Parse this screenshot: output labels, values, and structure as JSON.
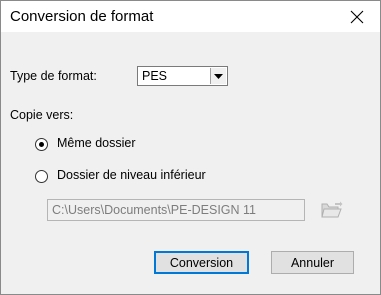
{
  "window": {
    "title": "Conversion de format",
    "close_glyph": "✕"
  },
  "format": {
    "label": "Type de format:",
    "selected": "PES"
  },
  "copy": {
    "label": "Copie vers:",
    "options": [
      {
        "label": "Même dossier",
        "selected": true
      },
      {
        "label": "Dossier de niveau inférieur",
        "selected": false
      }
    ],
    "path": "C:\\Users\\Documents\\PE-DESIGN 11"
  },
  "buttons": {
    "convert": "Conversion",
    "cancel": "Annuler"
  },
  "colors": {
    "accent": "#0078d7",
    "dialog_bg": "#f0f0f0",
    "disabled_text": "#7d7d7d"
  },
  "icons": [
    "close-icon",
    "dropdown-arrow-icon",
    "folder-open-icon"
  ]
}
